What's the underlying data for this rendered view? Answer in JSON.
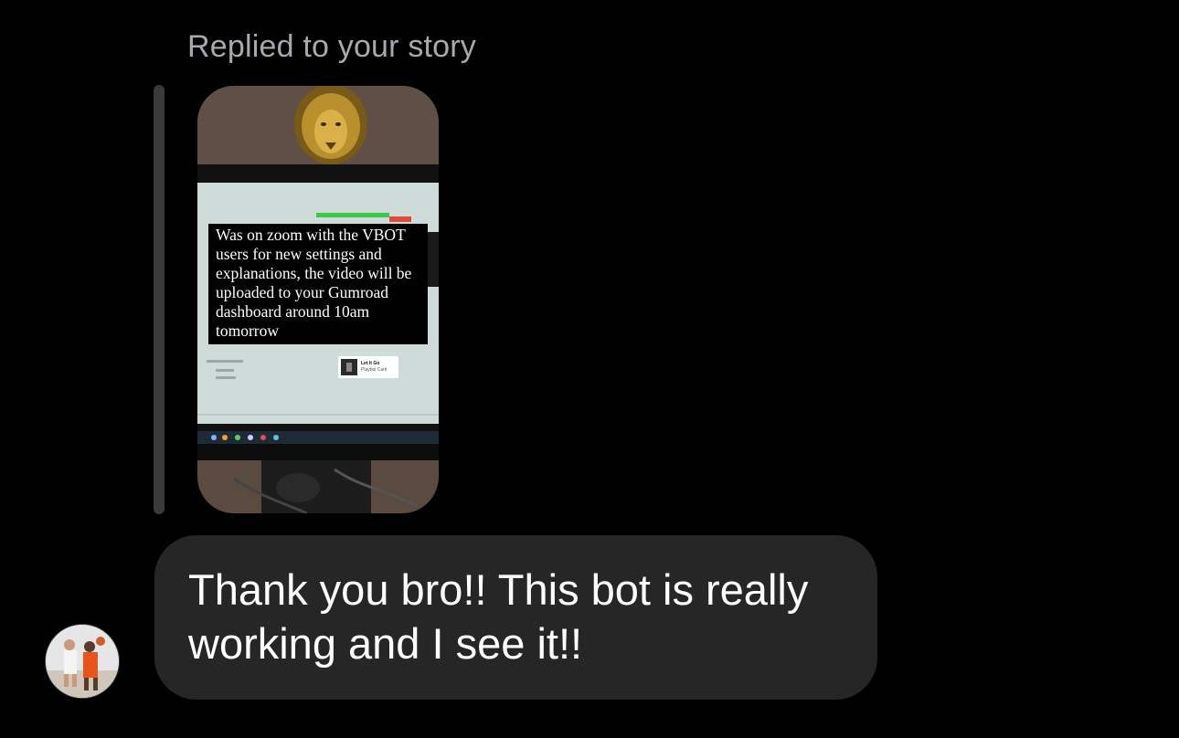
{
  "reply_header": {
    "label": "Replied to your story"
  },
  "story": {
    "caption": "Was on zoom with the VBOT users for new settings and explanations, the video will be uploaded to your Gumroad dashboard around 10am tomorrow",
    "music_sticker": {
      "title": "Let It Go",
      "artist": "Playboi Carti"
    }
  },
  "message": {
    "text": "Thank you bro!! This bot is really working and I see it!!"
  },
  "sender": {
    "avatar_icon": "avatar-photo"
  },
  "colors": {
    "background": "#000000",
    "bubble": "#262626",
    "label": "#a8a8ad",
    "quote_bar": "#3a3a3c"
  }
}
